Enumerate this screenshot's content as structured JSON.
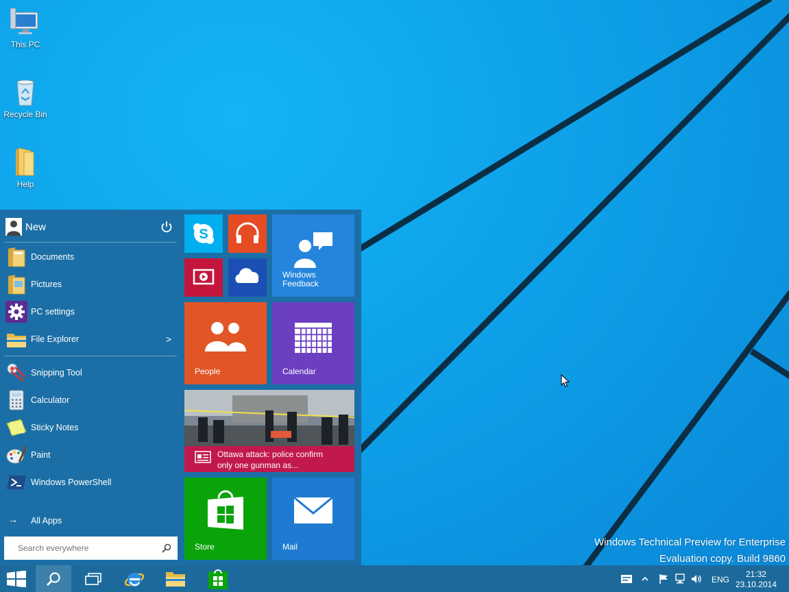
{
  "desktop": {
    "icons": [
      {
        "label": "This PC",
        "icon": "this-pc-icon"
      },
      {
        "label": "Recycle Bin",
        "icon": "recycle-bin-icon"
      },
      {
        "label": "Help",
        "icon": "folder-icon"
      }
    ],
    "watermark": {
      "line1": "Windows Technical Preview for Enterprise",
      "line2": "Evaluation copy. Build 9860"
    }
  },
  "start_menu": {
    "user": {
      "name": "New"
    },
    "places": [
      {
        "label": "Documents",
        "icon": "documents-folder-icon"
      },
      {
        "label": "Pictures",
        "icon": "pictures-folder-icon"
      },
      {
        "label": "PC settings",
        "icon": "gear-icon"
      },
      {
        "label": "File Explorer",
        "icon": "file-explorer-icon",
        "chevron": ">"
      }
    ],
    "apps": [
      {
        "label": "Snipping Tool",
        "icon": "snipping-tool-icon"
      },
      {
        "label": "Calculator",
        "icon": "calculator-icon"
      },
      {
        "label": "Sticky Notes",
        "icon": "sticky-notes-icon"
      },
      {
        "label": "Paint",
        "icon": "paint-icon"
      },
      {
        "label": "Windows PowerShell",
        "icon": "powershell-icon"
      }
    ],
    "all_apps_label": "All Apps",
    "all_apps_arrow": "→",
    "search_placeholder": "Search everywhere",
    "tiles": {
      "feedback": {
        "label_line1": "Windows",
        "label_line2": "Feedback"
      },
      "people": {
        "label": "People"
      },
      "calendar": {
        "label": "Calendar"
      },
      "news": {
        "headline_line1": "Ottawa attack: police confirm",
        "headline_line2": "only one gunman as..."
      },
      "store": {
        "label": "Store"
      },
      "mail": {
        "label": "Mail"
      }
    }
  },
  "taskbar": {
    "tray": {
      "language": "ENG",
      "time": "21:32",
      "date": "23.10.2014"
    }
  },
  "colors": {
    "start_bg": "#1b6fa6",
    "taskbar_bg": "#1c6a9c",
    "tile_skype": "#00aff0",
    "tile_music": "#e54c24",
    "tile_video": "#c4163c",
    "tile_onedrive": "#1c4fb3",
    "tile_feedback": "#2585dc",
    "tile_people": "#e15527",
    "tile_calendar": "#6b3fbf",
    "tile_news": "#c1194e",
    "tile_store": "#0aa30a",
    "tile_mail": "#1e7bd1"
  }
}
